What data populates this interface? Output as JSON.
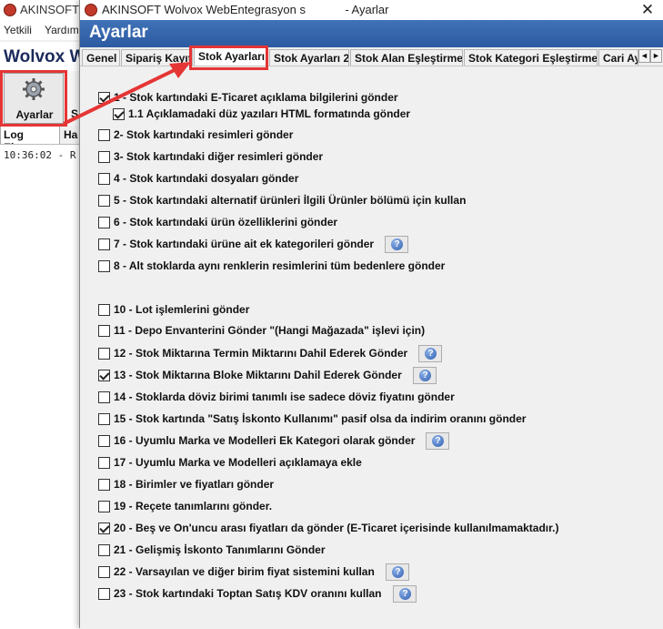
{
  "background_app": {
    "title": "AKINSOFT W",
    "menu": [
      "Yetkili",
      "Yardım"
    ],
    "brand": "Wolvox W",
    "toolbar_button": "Ayarlar",
    "toolbar_partial": "S",
    "tabs": [
      "Log Ekranı",
      "Ha"
    ],
    "log_line": "10:36:02 - R"
  },
  "dialog": {
    "title": "AKINSOFT Wolvox WebEntegrasyon s            - Ayarlar",
    "close_label": "✕",
    "banner_title": "Ayarlar",
    "tabs": [
      "Genel",
      "Sipariş Kayıt",
      "Stok Ayarları",
      "Stok Ayarları 2",
      "Stok Alan Eşleştirme",
      "Stok Kategori Eşleştirme",
      "Cari Ay"
    ],
    "active_tab_index": 2,
    "scroll_left": "◄",
    "scroll_right": "►"
  },
  "options": [
    {
      "label": "1 - Stok kartındaki E-Ticaret açıklama bilgilerini gönder",
      "checked": true,
      "help": false
    },
    {
      "label": "1.1 Açıklamadaki düz yazıları HTML formatında gönder",
      "checked": true,
      "help": false,
      "sub": true
    },
    {
      "label": "2- Stok kartındaki resimleri gönder",
      "checked": false,
      "help": false
    },
    {
      "label": "3- Stok kartındaki diğer resimleri gönder",
      "checked": false,
      "help": false
    },
    {
      "label": "4 - Stok kartındaki dosyaları gönder",
      "checked": false,
      "help": false
    },
    {
      "label": "5 - Stok kartındaki alternatif ürünleri İlgili Ürünler bölümü için kullan",
      "checked": false,
      "help": false
    },
    {
      "label": "6 - Stok kartındaki ürün özelliklerini gönder",
      "checked": false,
      "help": false
    },
    {
      "label": "7 - Stok kartındaki ürüne ait ek kategorileri gönder",
      "checked": false,
      "help": true
    },
    {
      "label": "8 - Alt stoklarda aynı renklerin resimlerini tüm bedenlere gönder",
      "checked": false,
      "help": false
    },
    {
      "label": "10 - Lot işlemlerini gönder",
      "checked": false,
      "help": false
    },
    {
      "label": "11 - Depo Envanterini Gönder \"(Hangi Mağazada\" işlevi için)",
      "checked": false,
      "help": false
    },
    {
      "label": "12 - Stok Miktarına Termin Miktarını Dahil Ederek Gönder",
      "checked": false,
      "help": true
    },
    {
      "label": "13 - Stok Miktarına Bloke Miktarını Dahil Ederek Gönder",
      "checked": true,
      "help": true
    },
    {
      "label": "14 - Stoklarda döviz birimi tanımlı ise sadece döviz fiyatını gönder",
      "checked": false,
      "help": false
    },
    {
      "label": "15 - Stok kartında \"Satış İskonto Kullanımı\" pasif olsa da indirim oranını gönder",
      "checked": false,
      "help": false
    },
    {
      "label": "16 - Uyumlu Marka ve Modelleri Ek Kategori olarak gönder",
      "checked": false,
      "help": true
    },
    {
      "label": "17 - Uyumlu Marka ve Modelleri açıklamaya ekle",
      "checked": false,
      "help": false
    },
    {
      "label": "18 - Birimler ve fiyatları gönder",
      "checked": false,
      "help": false
    },
    {
      "label": "19 - Reçete tanımlarını gönder.",
      "checked": false,
      "help": false
    },
    {
      "label": "20 - Beş ve On'uncu arası fiyatları da gönder (E-Ticaret içerisinde kullanılmamaktadır.)",
      "checked": true,
      "help": false
    },
    {
      "label": "21 - Gelişmiş İskonto Tanımlarını Gönder",
      "checked": false,
      "help": false
    },
    {
      "label": "22 - Varsayılan ve diğer birim fiyat sistemini kullan",
      "checked": false,
      "help": true
    },
    {
      "label": "23 - Stok kartındaki Toptan Satış KDV oranını kullan",
      "checked": false,
      "help": true
    }
  ],
  "colors": {
    "banner": "#2d5aa0",
    "highlight": "#e53535"
  }
}
